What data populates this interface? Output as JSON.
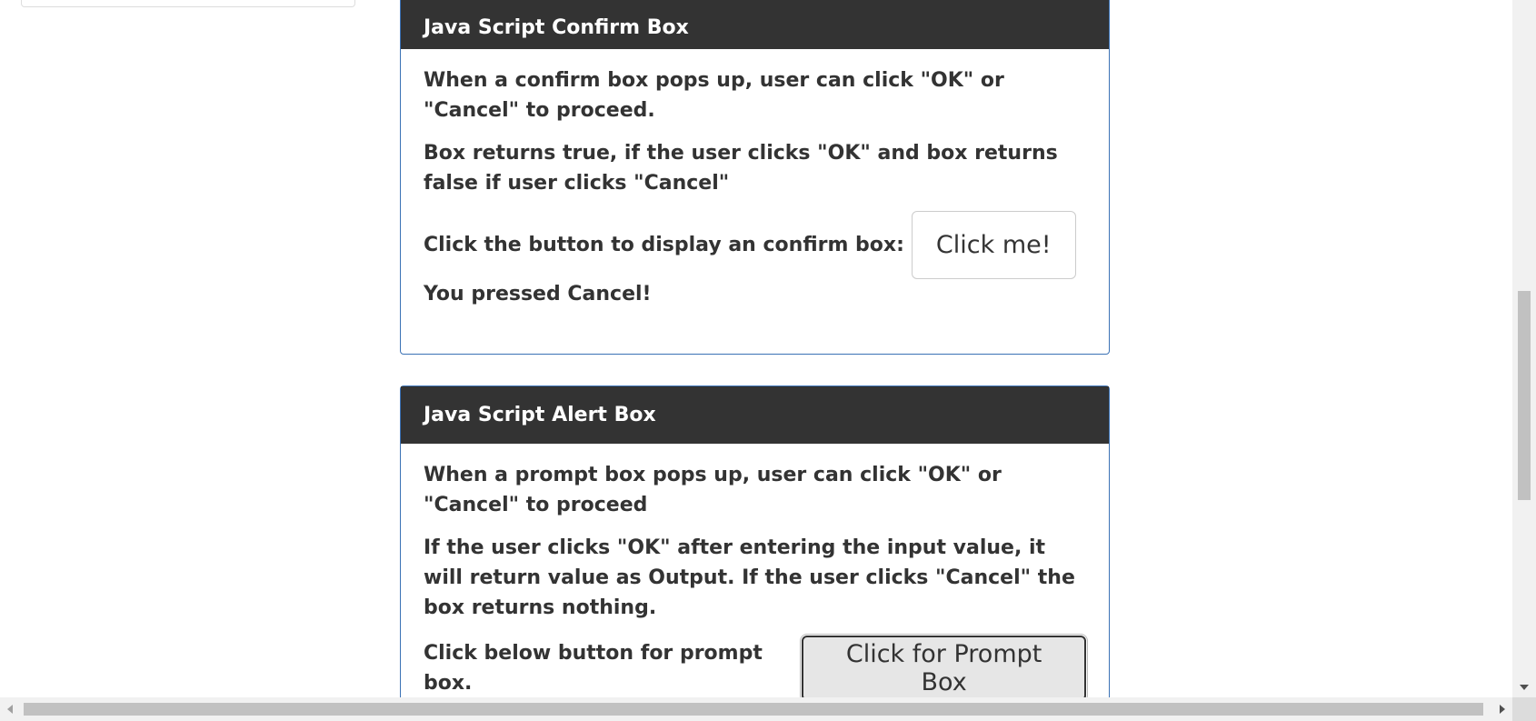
{
  "confirm_panel": {
    "title": "Java Script Confirm Box",
    "para1": "When a confirm box pops up, user can click \"OK\" or \"Cancel\" to proceed.",
    "para2": "Box returns true, if the user clicks \"OK\" and box returns false if user clicks \"Cancel\"",
    "instruction": "Click the button to display an confirm box:",
    "button_label": "Click me!",
    "result": "You pressed Cancel!"
  },
  "prompt_panel": {
    "title": "Java Script Alert Box",
    "para1": "When a prompt box pops up, user can click \"OK\" or \"Cancel\" to proceed",
    "para2": "If the user clicks \"OK\" after entering the input value, it will return value as Output. If the user clicks \"Cancel\" the box returns nothing.",
    "instruction": "Click below button for prompt box.",
    "button_label": "Click for Prompt Box"
  },
  "colors": {
    "panel_heading_bg": "#333333",
    "panel_border": "#3b72b5"
  }
}
